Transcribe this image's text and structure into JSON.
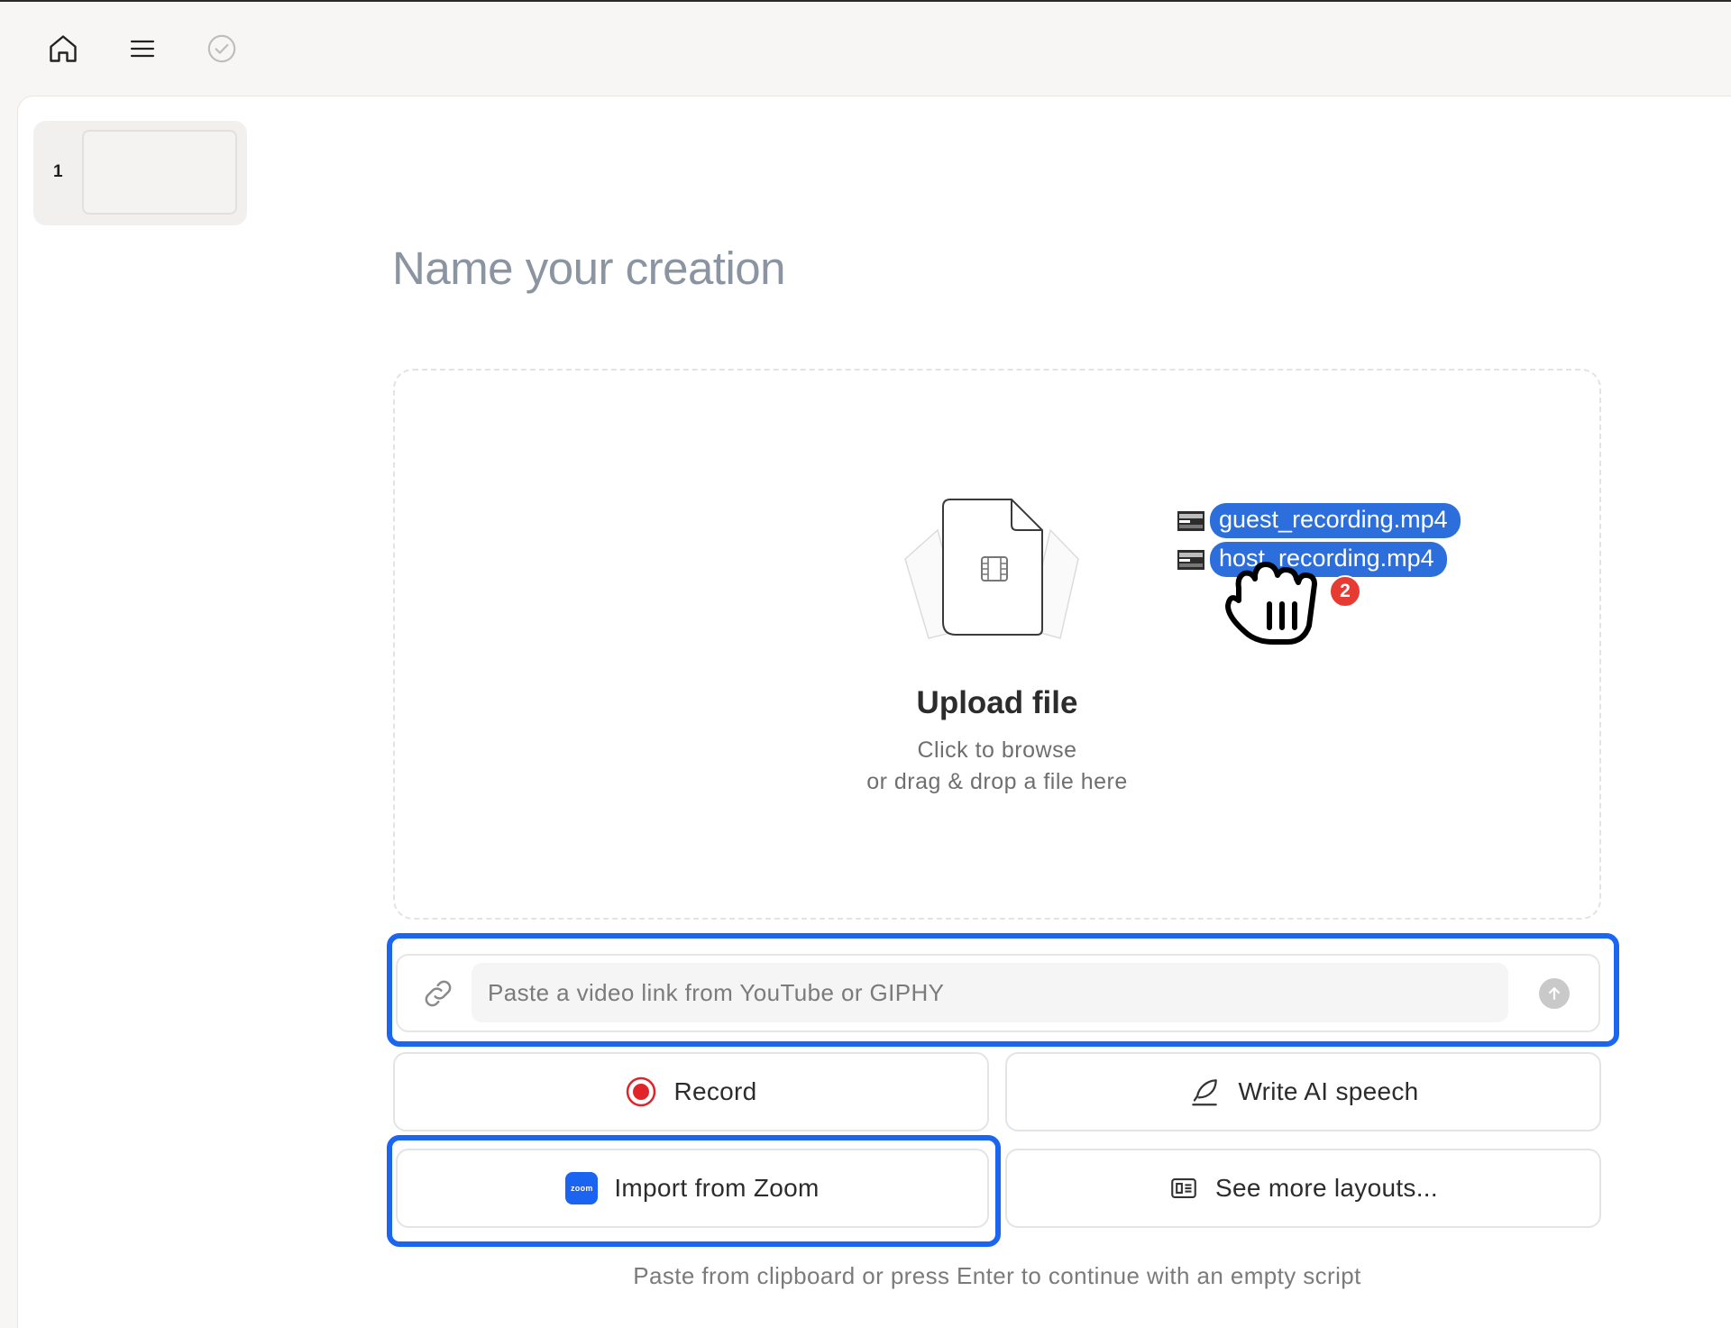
{
  "toolbar": {
    "home_icon": "home-icon",
    "menu_icon": "menu-icon",
    "status_icon": "check-circle-icon"
  },
  "scenes": {
    "items": [
      {
        "number": "1"
      }
    ]
  },
  "editor": {
    "title_placeholder": "Name your creation"
  },
  "upload": {
    "title": "Upload file",
    "line1": "Click to browse",
    "line2": "or drag & drop a file here",
    "dragged_files": [
      "guest_recording.mp4",
      "host_recording.mp4"
    ],
    "dragged_count": "2"
  },
  "link": {
    "placeholder": "Paste a video link from YouTube or GIPHY",
    "value": ""
  },
  "actions": {
    "record": "Record",
    "write_ai": "Write AI speech",
    "import_zoom": "Import from Zoom",
    "zoom_logo_text": "zoom",
    "more_layouts": "See more layouts..."
  },
  "hint": "Paste from clipboard or press Enter to continue with an empty script",
  "colors": {
    "highlight": "#1a66f0",
    "drag_pill": "#2c6fdc",
    "badge": "#e63a32",
    "record": "#e0242a",
    "zoom": "#1b63f1"
  }
}
